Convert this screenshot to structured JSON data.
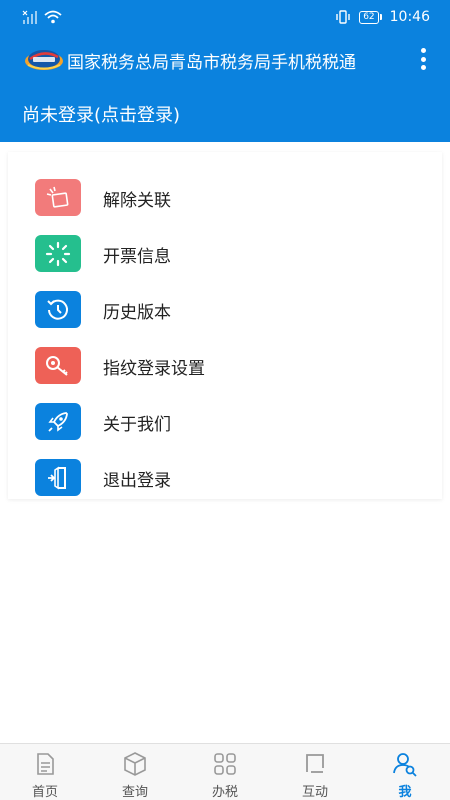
{
  "status_bar": {
    "time": "10:46",
    "battery": "62"
  },
  "app_bar": {
    "title": "国家税务总局青岛市税务局手机税税通"
  },
  "login": {
    "text": "尚未登录(点击登录)"
  },
  "menu": {
    "items": [
      {
        "label": "解除关联",
        "icon": "unlink-icon",
        "color": "#f27b7b"
      },
      {
        "label": "开票信息",
        "icon": "loading-spinner-icon",
        "color": "#25bf8e"
      },
      {
        "label": "历史版本",
        "icon": "history-clock-icon",
        "color": "#0b82de"
      },
      {
        "label": "指纹登录设置",
        "icon": "key-icon",
        "color": "#ee6157"
      },
      {
        "label": "关于我们",
        "icon": "rocket-icon",
        "color": "#0b82de"
      },
      {
        "label": "退出登录",
        "icon": "logout-door-icon",
        "color": "#0b82de"
      }
    ]
  },
  "tabs": [
    {
      "label": "首页",
      "icon": "document-icon",
      "active": false
    },
    {
      "label": "查询",
      "icon": "cube-icon",
      "active": false
    },
    {
      "label": "办税",
      "icon": "grid-icon",
      "active": false
    },
    {
      "label": "互动",
      "icon": "bracket-icon",
      "active": false
    },
    {
      "label": "我",
      "icon": "user-search-icon",
      "active": true
    }
  ],
  "colors": {
    "brand": "#0b82de",
    "tab_inactive": "#555555"
  }
}
